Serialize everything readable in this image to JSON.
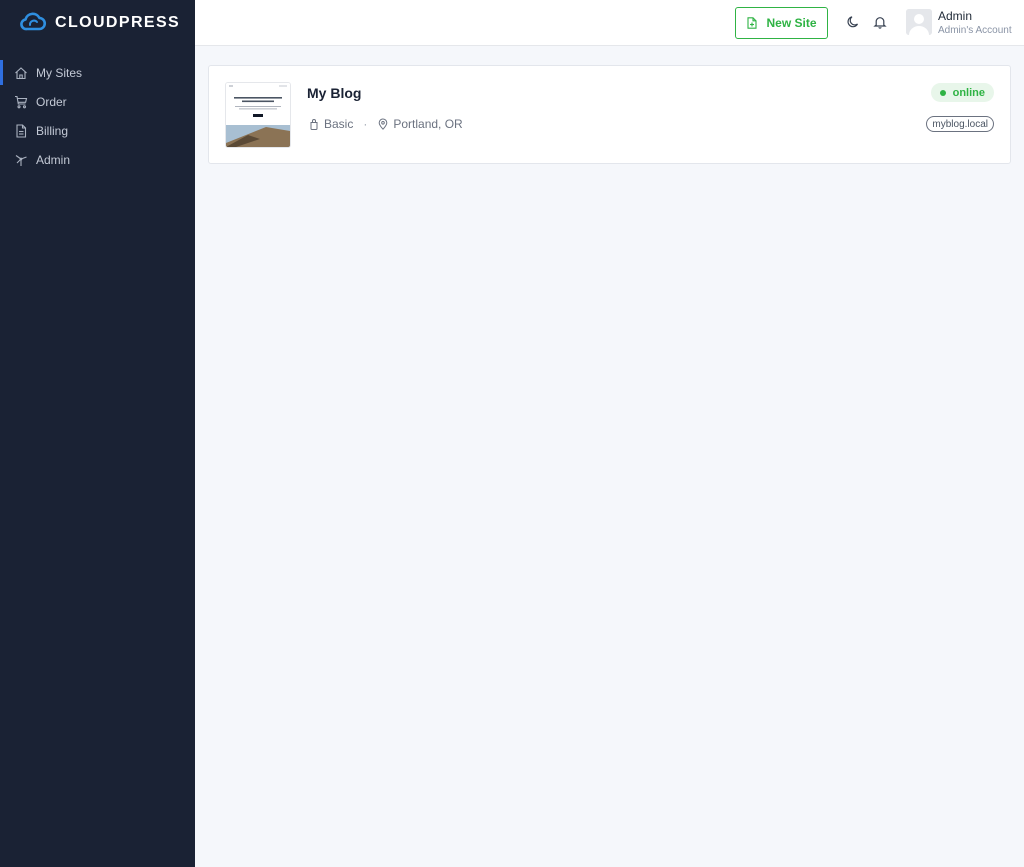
{
  "brand": {
    "name": "CLOUDPRESS",
    "icon": "cloud-logo-icon",
    "color": "#2f8fe0"
  },
  "sidebar": {
    "items": [
      {
        "label": "My Sites",
        "icon": "home-icon",
        "active": true
      },
      {
        "label": "Order",
        "icon": "cart-icon",
        "active": false
      },
      {
        "label": "Billing",
        "icon": "receipt-icon",
        "active": false
      },
      {
        "label": "Admin",
        "icon": "windmill-icon",
        "active": false
      }
    ]
  },
  "header": {
    "new_site_label": "New Site",
    "theme_icon": "moon-icon",
    "notifications_icon": "bell-icon",
    "user": {
      "name": "Admin",
      "role": "Admin's Account"
    }
  },
  "sites": [
    {
      "title": "My Blog",
      "plan": "Basic",
      "location": "Portland, OR",
      "status": "online",
      "domain": "myblog.local"
    }
  ],
  "colors": {
    "sidebar_bg": "#1a2234",
    "accent": "#2f6fe0",
    "success": "#2fb344",
    "page_bg": "#f5f7fb"
  }
}
